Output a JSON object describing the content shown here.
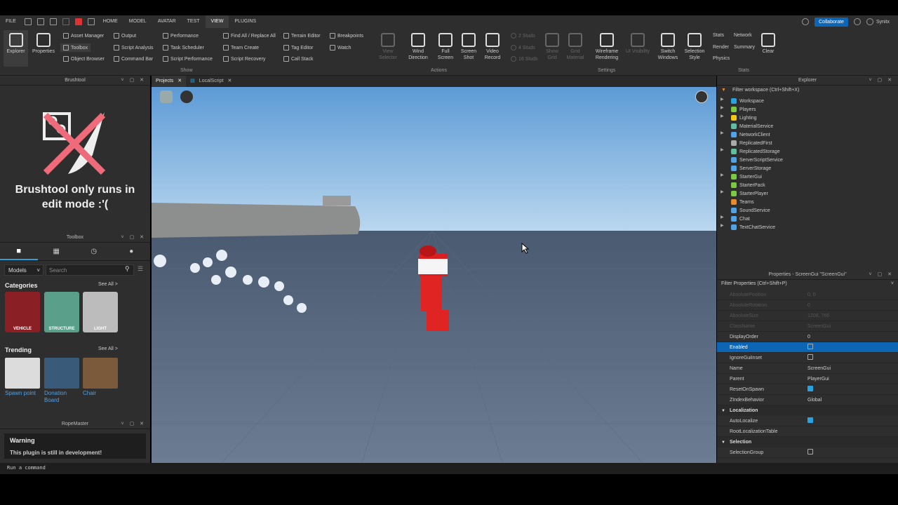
{
  "menu": [
    "FILE",
    "HOME",
    "MODEL",
    "AVATAR",
    "TEST",
    "VIEW",
    "PLUGINS"
  ],
  "topright": {
    "collaborate": "Collaborate",
    "user": "Synitx"
  },
  "ribbon": {
    "explorer": "Explorer",
    "properties": "Properties",
    "show_items": [
      "Asset Manager",
      "Toolbox",
      "Object Browser",
      "Output",
      "Script Analysis",
      "Command Bar",
      "Performance",
      "Task Scheduler",
      "Script Performance",
      "Find All / Replace All",
      "Team Create",
      "Script Recovery",
      "Terrain Editor",
      "Tag Editor",
      "Call Stack",
      "Breakpoints",
      "Watch"
    ],
    "show_label": "Show",
    "actions": [
      "View Selector",
      "Wind Direction",
      "Full Screen",
      "Screen Shot",
      "Video Record"
    ],
    "actions_label": "Actions",
    "studs": [
      "2 Studs",
      "4 Studs",
      "16 Studs"
    ],
    "settings": [
      "Show Grid",
      "Grid Material",
      "Wireframe Rendering",
      "UI Visibility",
      "Switch Windows",
      "Selection Style"
    ],
    "settings_label": "Settings",
    "stats": [
      "Stats",
      "Network",
      "Render",
      "Summary",
      "Physics",
      "Clear"
    ],
    "stats_label": "Stats"
  },
  "brushtool": {
    "title": "Brushtool",
    "message": "Brushtool only runs in edit mode :'("
  },
  "toolbox": {
    "title": "Toolbox",
    "dropdown": "Models",
    "search_placeholder": "Search",
    "categories": "Categories",
    "see_all": "See All >",
    "cards": [
      "VEHICLE",
      "STRUCTURE",
      "LIGHT"
    ],
    "trending": "Trending",
    "trend_items": [
      "Spawn point",
      "Donation Board",
      "Chair"
    ]
  },
  "ropemaster": {
    "title": "RopeMaster",
    "warning": "Warning",
    "text": "This plugin is still in development!"
  },
  "tabs": [
    "Projects",
    "LocalScript"
  ],
  "explorer": {
    "title": "Explorer",
    "filter": "Filter workspace (Ctrl+Shift+X)",
    "items": [
      "Workspace",
      "Players",
      "Lighting",
      "MaterialService",
      "NetworkClient",
      "ReplicatedFirst",
      "ReplicatedStorage",
      "ServerScriptService",
      "ServerStorage",
      "StarterGui",
      "StarterPack",
      "StarterPlayer",
      "Teams",
      "SoundService",
      "Chat",
      "TextChatService"
    ]
  },
  "properties": {
    "title": "Properties - ScreenGui \"ScreenGui\"",
    "filter": "Filter Properties (Ctrl+Shift+P)",
    "dim_rows": [
      [
        "AbsolutePosition",
        "0, 0"
      ],
      [
        "AbsoluteRotation",
        "0"
      ],
      [
        "AbsoluteSize",
        "1208, 766"
      ],
      [
        "ClassName",
        "ScreenGui"
      ]
    ],
    "rows": [
      [
        "DisplayOrder",
        "0"
      ],
      [
        "Enabled",
        ""
      ],
      [
        "IgnoreGuiInset",
        ""
      ],
      [
        "Name",
        "ScreenGui"
      ],
      [
        "Parent",
        "PlayerGui"
      ],
      [
        "ResetOnSpawn",
        ""
      ],
      [
        "ZIndexBehavior",
        "Global"
      ]
    ],
    "sec_localization": "Localization",
    "loc_rows": [
      [
        "AutoLocalize",
        ""
      ],
      [
        "RootLocalizationTable",
        ""
      ]
    ],
    "sec_selection": "Selection",
    "sel_rows": [
      [
        "SelectionGroup",
        ""
      ]
    ]
  },
  "command": {
    "placeholder": "Run a command"
  }
}
